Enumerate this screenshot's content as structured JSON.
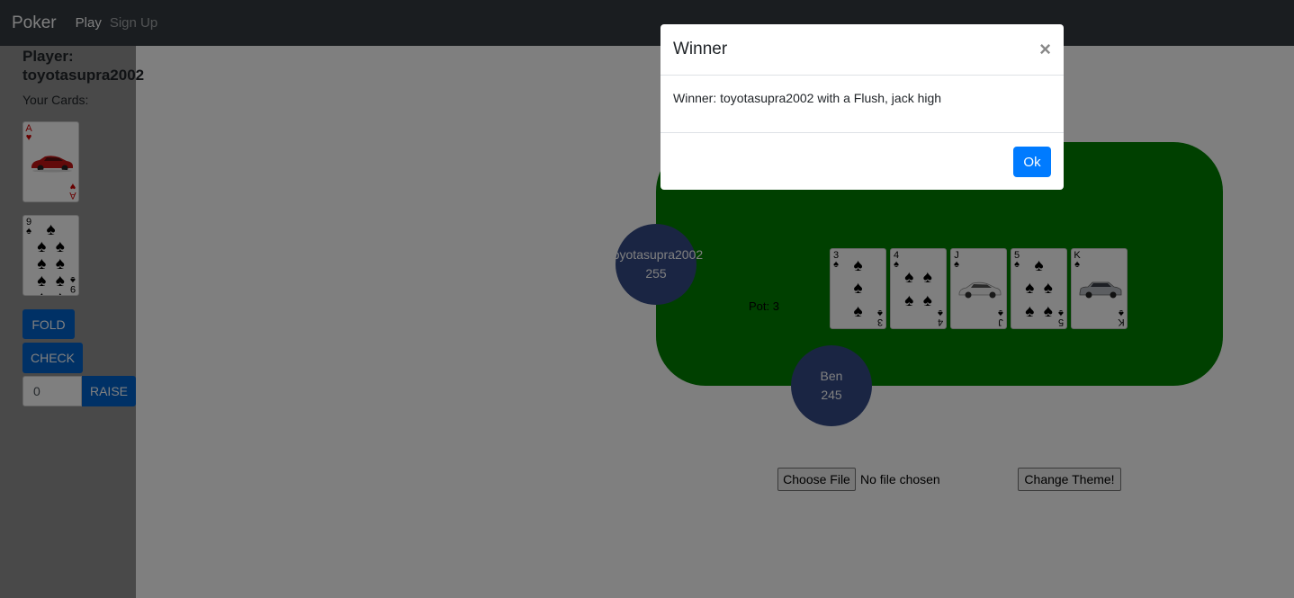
{
  "navbar": {
    "brand": "Poker",
    "links": [
      "Play",
      "Sign Up"
    ]
  },
  "player": {
    "title_line1": "Player:",
    "title_line2": "toyotasupra2002",
    "cards_label": "Your Cards:",
    "cards": [
      {
        "rank": "A",
        "suit": "♥",
        "color": "#d10000",
        "art": "red-car-icon"
      },
      {
        "rank": "9",
        "suit": "♠",
        "color": "#000000",
        "pip_count": 9
      }
    ],
    "actions": {
      "fold": "FOLD",
      "check": "CHECK",
      "raise": "RAISE"
    },
    "raise_value": "0"
  },
  "table": {
    "pot_label": "Pot: 3",
    "seats": [
      {
        "name": "toyotasupra2002",
        "chips": "255"
      },
      {
        "name": "Ben",
        "chips": "245"
      }
    ],
    "community_cards": [
      {
        "rank": "3",
        "suit": "♠",
        "pip_count": 3
      },
      {
        "rank": "4",
        "suit": "♠",
        "pip_count": 4
      },
      {
        "rank": "J",
        "suit": "♠",
        "art": "white-car-icon"
      },
      {
        "rank": "5",
        "suit": "♠",
        "pip_count": 5
      },
      {
        "rank": "K",
        "suit": "♠",
        "art": "silver-car-icon"
      }
    ],
    "felt_color": "#008000",
    "seat_color": "#344a86"
  },
  "controls": {
    "file_button": "Choose File",
    "file_status": "No file chosen",
    "theme_button": "Change Theme!"
  },
  "modal": {
    "title": "Winner",
    "close": "×",
    "message": "Winner: toyotasupra2002 with a Flush, jack high",
    "ok": "Ok"
  }
}
